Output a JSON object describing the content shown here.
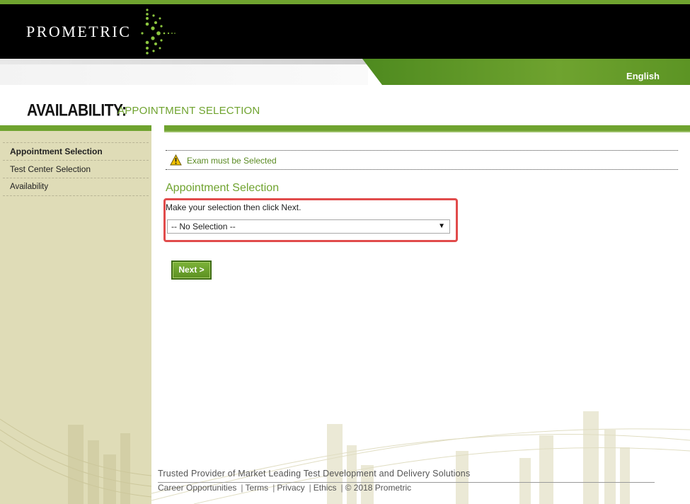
{
  "header": {
    "logo_text": "PROMETRIC",
    "language": "English",
    "brand_color": "#6fa32f"
  },
  "page": {
    "title_main": "AVAILABILITY:",
    "title_sub": "APPOINTMENT SELECTION"
  },
  "sidebar": {
    "items": [
      {
        "label": "Appointment Selection",
        "active": true
      },
      {
        "label": "Test Center Selection",
        "active": false
      },
      {
        "label": "Availability",
        "active": false
      }
    ]
  },
  "main": {
    "warning": {
      "icon": "warning-icon",
      "text": "Exam must be Selected"
    },
    "section_title": "Appointment Selection",
    "instruction": "Make your selection then click Next.",
    "select": {
      "value": "-- No Selection --"
    },
    "next_label": "Next >"
  },
  "footer": {
    "tagline": "Trusted Provider of Market Leading Test Development and Delivery Solutions",
    "links": [
      "Career Opportunities",
      "Terms",
      "Privacy",
      "Ethics"
    ],
    "copyright": "© 2018 Prometric"
  },
  "colors": {
    "accent": "#6fa32f",
    "highlight": "#e14b4b",
    "sidebar_bg": "#dfdcb7"
  }
}
